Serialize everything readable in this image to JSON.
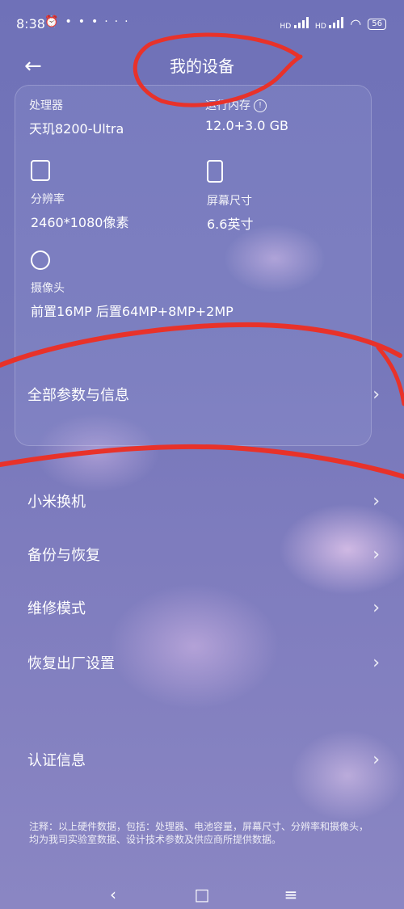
{
  "status_bar": {
    "time": "8:38",
    "left_icons": [
      "alarm-icon",
      "weibo-icon",
      "app-icon",
      "app-icon"
    ],
    "more": "···",
    "hd1": "HD",
    "hd2": "HD",
    "battery": "56"
  },
  "header": {
    "back": "←",
    "title": "我的设备"
  },
  "specs": {
    "cpu": {
      "label": "处理器",
      "value": "天玑8200-Ultra"
    },
    "ram": {
      "label": "运行内存",
      "value": "12.0+3.0 GB",
      "info": "!"
    },
    "resolution": {
      "label": "分辨率",
      "value": "2460*1080像素"
    },
    "screen": {
      "label": "屏幕尺寸",
      "value": "6.6英寸"
    },
    "camera": {
      "label": "摄像头",
      "value": "前置16MP 后置64MP+8MP+2MP"
    }
  },
  "menu": {
    "all_params": "全部参数与信息",
    "mi_mover": "小米换机",
    "backup": "备份与恢复",
    "repair": "维修模式",
    "factory_reset": "恢复出厂设置",
    "certification": "认证信息",
    "chevron": "›"
  },
  "footnote": "注释：以上硬件数据，包括：处理器、电池容量，屏幕尺寸、分辨率和摄像头，均为我司实验室数据、设计技术参数及供应商所提供数据。",
  "nav": {
    "back": "‹",
    "home": "□",
    "menu": "≡"
  },
  "colors": {
    "annotation": "#e8322a"
  }
}
